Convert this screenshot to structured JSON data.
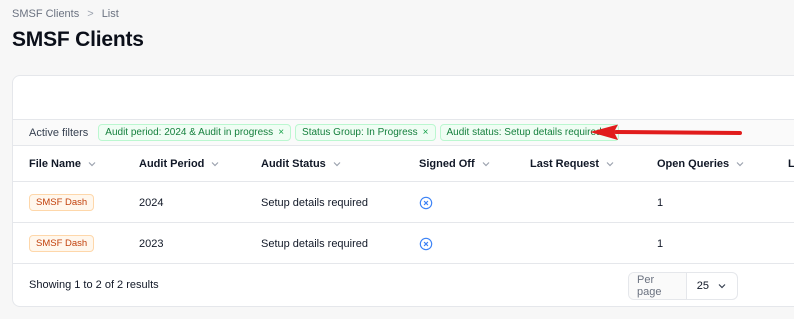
{
  "breadcrumb": {
    "items": [
      "SMSF Clients",
      "List"
    ],
    "separator": ">"
  },
  "page": {
    "title": "SMSF Clients"
  },
  "filters": {
    "label": "Active filters",
    "chips": [
      "Audit period: 2024 & Audit in progress",
      "Status Group: In Progress",
      "Audit status: Setup details required"
    ],
    "remove_glyph": "×"
  },
  "table": {
    "columns": [
      "File Name",
      "Audit Period",
      "Audit Status",
      "Signed Off",
      "Last Request",
      "Open Queries",
      "L"
    ],
    "rows": [
      {
        "file_name": "SMSF Dash",
        "audit_period": "2024",
        "audit_status": "Setup details required",
        "signed_off_icon": "x-circle-icon",
        "last_request": "",
        "open_queries": "1"
      },
      {
        "file_name": "SMSF Dash",
        "audit_period": "2023",
        "audit_status": "Setup details required",
        "signed_off_icon": "x-circle-icon",
        "last_request": "",
        "open_queries": "1"
      }
    ]
  },
  "footer": {
    "summary": "Showing 1 to 2 of 2 results",
    "per_page_label": "Per page",
    "per_page_value": "25"
  },
  "colors": {
    "chip_text": "#15803d",
    "badge_text": "#c2410c",
    "signed_off_icon": "#3b82f6",
    "arrow": "#e11d1d"
  }
}
